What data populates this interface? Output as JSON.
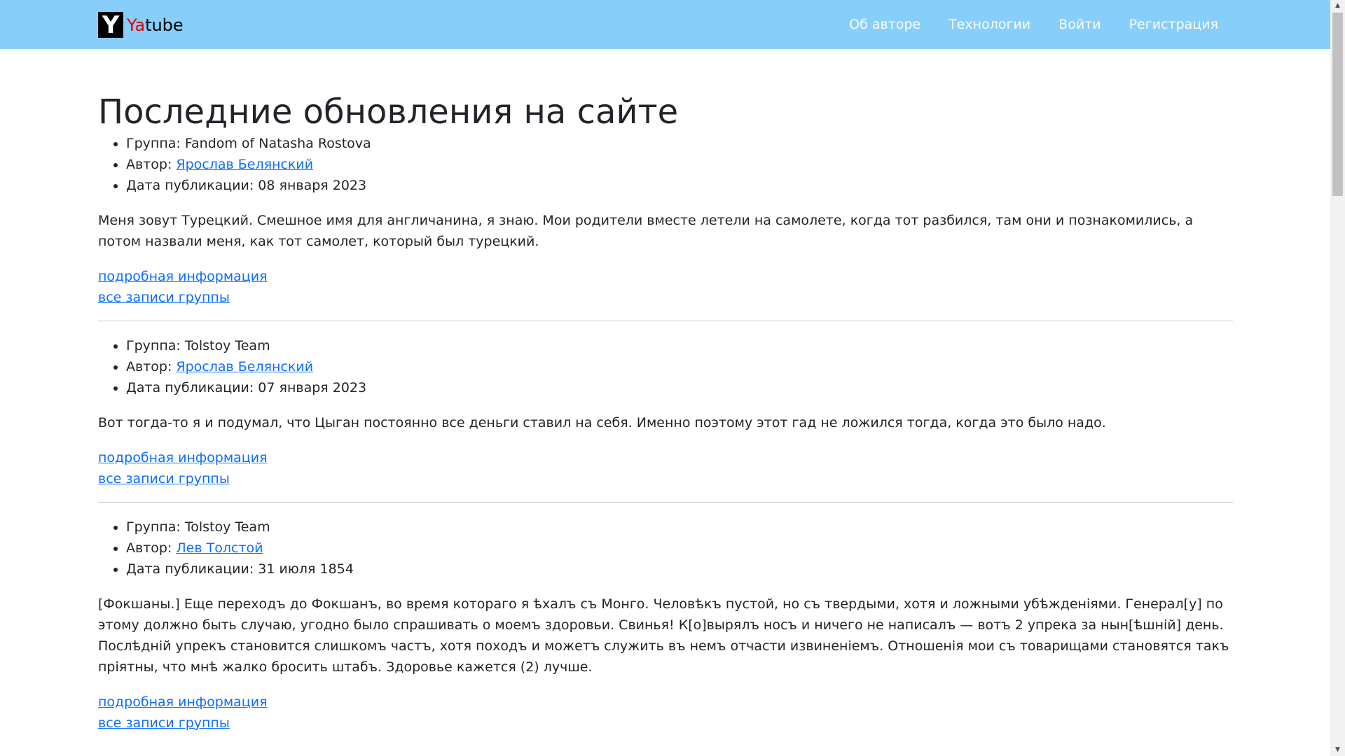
{
  "navbar": {
    "brand_logo_letter": "Y",
    "brand_accent": "Ya",
    "brand_rest": "tube",
    "links": [
      "Об авторе",
      "Технологии",
      "Войти",
      "Регистрация"
    ]
  },
  "main": {
    "title": "Последние обновления на сайте",
    "posts": [
      {
        "group_label": "Группа: Fandom of Natasha Rostova",
        "author_label": "Автор: ",
        "author_name": "Ярослав Белянский",
        "date_label": "Дата публикации: 08 января 2023",
        "text": "Меня зовут Турецкий. Смешное имя для англичанина, я знаю. Мои родители вместе летели на самолете, когда тот разбился, там они и познакомились, а потом назвали меня, как тот самолет, который был турецкий.",
        "details_link": "подробная информация",
        "group_link": "все записи группы"
      },
      {
        "group_label": "Группа: Tolstoy Team",
        "author_label": "Автор: ",
        "author_name": "Ярослав Белянский",
        "date_label": "Дата публикации: 07 января 2023",
        "text": "Вот тогда-то я и подумал, что Цыган постоянно все деньги ставил на себя. Именно поэтому этот гад не ложился тогда, когда это было надо.",
        "details_link": "подробная информация",
        "group_link": "все записи группы"
      },
      {
        "group_label": "Группа: Tolstoy Team",
        "author_label": "Автор: ",
        "author_name": "Лев Толстой",
        "date_label": "Дата публикации: 31 июля 1854",
        "text": "[Фокшаны.] Еще переходъ до Фокшанъ, во время котораго я ѣхалъ съ Монго. Человѣкъ пустой, но съ твердыми, хотя и ложными убѣжденіями. Генерал[у] по этому должно быть случаю, угодно было спрашивать о моемъ здоровьи. Свинья! К[о]вырялъ носъ и ничего не написалъ — вотъ 2 упрека за нын[ѣшній] день. Послѣдній упрекъ становится слишкомъ частъ, хотя походъ и можетъ служить въ немъ отчасти извиненіемъ. Отношенія мои съ товарищами становятся такъ пріятны, что мнѣ жалко бросить штабъ. Здоровье кажется (2) лучше.",
        "details_link": "подробная информация",
        "group_link": "все записи группы"
      }
    ]
  },
  "colors": {
    "navbar_bg": "#87cefa",
    "link": "#0d6efd",
    "brand_accent": "#e60000"
  }
}
